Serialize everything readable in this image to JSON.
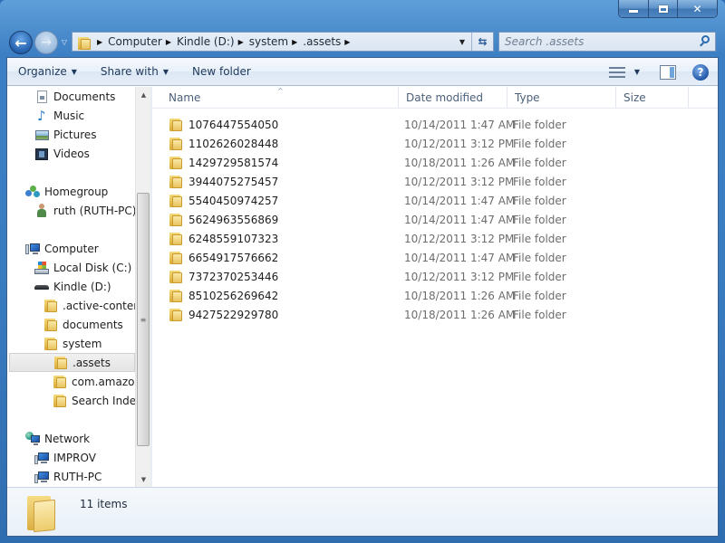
{
  "window": {
    "controls": {
      "minimize": "minimize",
      "maximize": "maximize",
      "close": "close"
    }
  },
  "navigation": {
    "back_icon": "back-arrow-icon",
    "forward_icon": "forward-arrow-icon",
    "breadcrumb": [
      "Computer",
      "Kindle (D:)",
      "system",
      ".assets"
    ],
    "search_placeholder": "Search .assets"
  },
  "commandbar": {
    "organize": "Organize",
    "share_with": "Share with",
    "new_folder": "New folder",
    "help": "?"
  },
  "navpane": {
    "libraries": [
      {
        "label": "Documents",
        "icon": "documents-icon"
      },
      {
        "label": "Music",
        "icon": "music-icon"
      },
      {
        "label": "Pictures",
        "icon": "pictures-icon"
      },
      {
        "label": "Videos",
        "icon": "videos-icon"
      }
    ],
    "homegroup": {
      "label": "Homegroup",
      "children": [
        {
          "label": "ruth (RUTH-PC)"
        }
      ]
    },
    "computer": {
      "label": "Computer",
      "drives": [
        {
          "label": "Local Disk (C:)"
        },
        {
          "label": "Kindle (D:)"
        }
      ],
      "kindle_folders": [
        {
          "label": ".active-content"
        },
        {
          "label": "documents"
        },
        {
          "label": "system"
        }
      ],
      "system_folders": [
        {
          "label": ".assets",
          "selected": true
        },
        {
          "label": "com.amazon"
        },
        {
          "label": "Search Indexe"
        }
      ]
    },
    "network": {
      "label": "Network",
      "children": [
        {
          "label": "IMPROV"
        },
        {
          "label": "RUTH-PC"
        }
      ]
    }
  },
  "filelist": {
    "columns": [
      "Name",
      "Date modified",
      "Type",
      "Size"
    ],
    "sort_column": "Name",
    "rows": [
      {
        "name": "1076447554050",
        "date": "10/14/2011 1:47 AM",
        "type": "File folder",
        "size": ""
      },
      {
        "name": "1102626028448",
        "date": "10/12/2011 3:12 PM",
        "type": "File folder",
        "size": ""
      },
      {
        "name": "1429729581574",
        "date": "10/18/2011 1:26 AM",
        "type": "File folder",
        "size": ""
      },
      {
        "name": "3944075275457",
        "date": "10/12/2011 3:12 PM",
        "type": "File folder",
        "size": ""
      },
      {
        "name": "5540450974257",
        "date": "10/14/2011 1:47 AM",
        "type": "File folder",
        "size": ""
      },
      {
        "name": "5624963556869",
        "date": "10/14/2011 1:47 AM",
        "type": "File folder",
        "size": ""
      },
      {
        "name": "6248559107323",
        "date": "10/12/2011 3:12 PM",
        "type": "File folder",
        "size": ""
      },
      {
        "name": "6654917576662",
        "date": "10/14/2011 1:47 AM",
        "type": "File folder",
        "size": ""
      },
      {
        "name": "7372370253446",
        "date": "10/12/2011 3:12 PM",
        "type": "File folder",
        "size": ""
      },
      {
        "name": "8510256269642",
        "date": "10/18/2011 1:26 AM",
        "type": "File folder",
        "size": ""
      },
      {
        "name": "9427522929780",
        "date": "10/18/2011 1:26 AM",
        "type": "File folder",
        "size": ""
      }
    ]
  },
  "details": {
    "item_count": "11 items"
  }
}
